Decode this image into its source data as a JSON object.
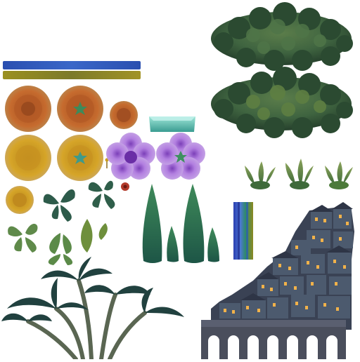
{
  "atlas": {
    "colors": {
      "background": "#ffffff",
      "bush_dark": "#2f4a34",
      "bush_mid": "#3f6440",
      "bush_light": "#5b7d4a",
      "bar_blue": "#2f55b8",
      "bar_olive": "#8a8a1e",
      "rose_orange": "#c0652a",
      "rose_yellow": "#d9a425",
      "flower_purple": "#a874d0",
      "leaf_teal": "#2d5b4a",
      "leaf_olive": "#6f8e3a",
      "cypress_green": "#2a6b4c",
      "tray_teal": "#5fc3b4",
      "house_slate": "#4c5a6e",
      "window_glow": "#f1b24a",
      "bridge_stone": "#4a4e5c",
      "palm_teal": "#21413f"
    },
    "sprites": [
      {
        "name": "bush-sprite",
        "kind": "bush"
      },
      {
        "name": "bush-sprite",
        "kind": "bush"
      },
      {
        "name": "color-bar",
        "kind": "bar",
        "color": "blue"
      },
      {
        "name": "color-bar",
        "kind": "bar",
        "color": "olive"
      },
      {
        "name": "rose-orange-sprite",
        "kind": "flower"
      },
      {
        "name": "rose-orange-star-sprite",
        "kind": "flower"
      },
      {
        "name": "rose-orange-small-sprite",
        "kind": "flower"
      },
      {
        "name": "rose-yellow-sprite",
        "kind": "flower"
      },
      {
        "name": "rose-yellow-star-sprite",
        "kind": "flower"
      },
      {
        "name": "flower-purple-sprite",
        "kind": "flower"
      },
      {
        "name": "flower-purple-star-sprite",
        "kind": "flower"
      },
      {
        "name": "rose-yellow-small-sprite",
        "kind": "flower"
      },
      {
        "name": "teal-tray-sprite",
        "kind": "prop"
      },
      {
        "name": "leaf-cluster-sprite",
        "kind": "foliage"
      },
      {
        "name": "cypress-tree-sprite",
        "kind": "tree"
      },
      {
        "name": "grass-tuft-sprite",
        "kind": "foliage"
      },
      {
        "name": "vertical-gradient-strip",
        "kind": "bar"
      },
      {
        "name": "hillside-town-sprite",
        "kind": "building"
      },
      {
        "name": "palm-trees-sprite",
        "kind": "tree"
      }
    ]
  }
}
